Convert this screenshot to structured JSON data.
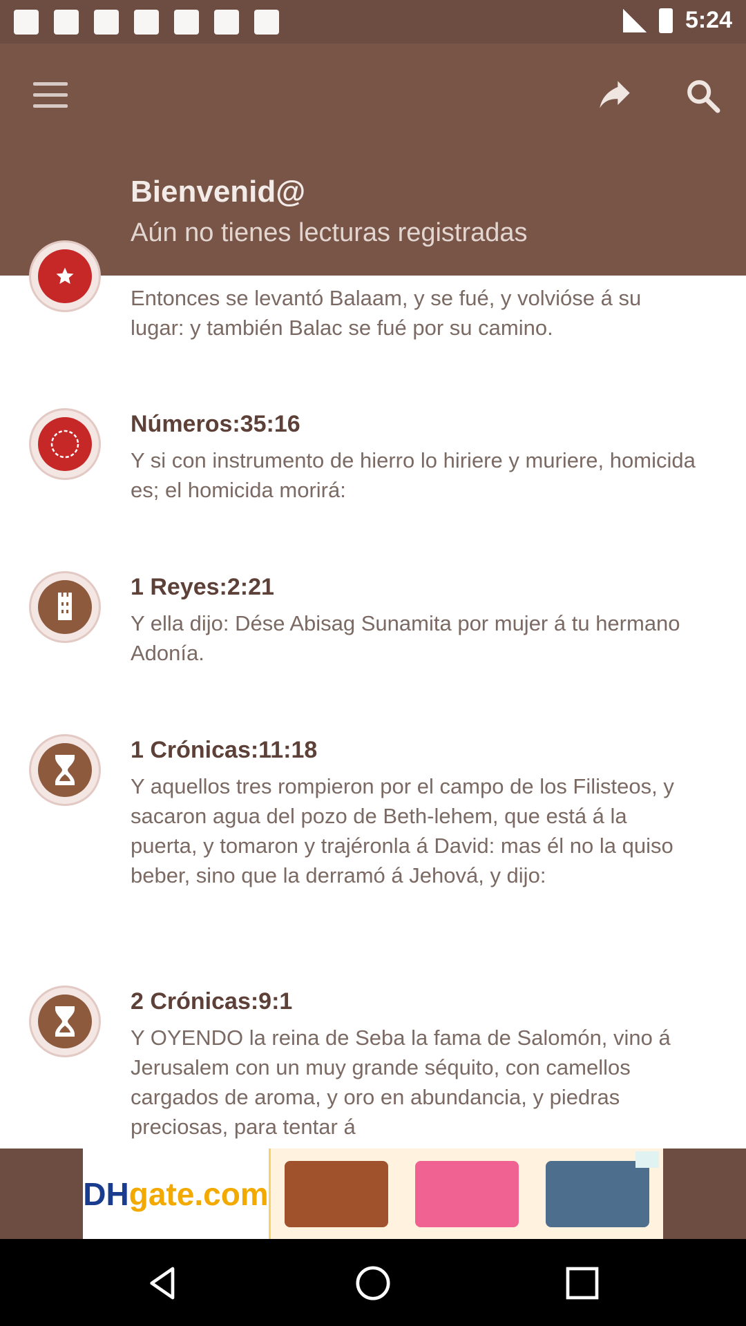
{
  "status_bar": {
    "time": "5:24"
  },
  "app_bar": {
    "welcome_title": "Bienvenid@",
    "welcome_subtitle": "Aún no tienes lecturas registradas",
    "icons": [
      "menu-icon",
      "share-icon",
      "search-icon"
    ]
  },
  "readings": [
    {
      "reference": "",
      "text": "Entonces se levantó Balaam, y se fué, y volvióse á su lugar: y también Balac se fué por su camino.",
      "badge_color": "#c62828"
    },
    {
      "reference": "Números:35:16",
      "text": "Y si con instrumento de hierro lo hiriere y muriere, homicida es; el homicida morirá:",
      "badge_color": "#c62828"
    },
    {
      "reference": "1 Reyes:2:21",
      "text": "Y ella dijo: Dése Abisag Sunamita por mujer á tu hermano Adonía.",
      "badge_color": "#8d5a3e"
    },
    {
      "reference": "1 Crónicas:11:18",
      "text": "Y aquellos tres rompieron por el campo de los Filisteos, y sacaron agua del pozo de Beth-lehem, que está á la puerta, y tomaron y trajéronla á David: mas él no la quiso beber, sino que la derramó á Jehová, y dijo:",
      "badge_color": "#8d5a3e"
    },
    {
      "reference": "2 Crónicas:9:1",
      "text": "Y OYENDO la reina de Seba la fama de Salomón, vino á Jerusalem con un muy grande séquito, con camellos cargados de aroma, y oro en abundancia, y piedras preciosas, para tentar á",
      "badge_color": "#8d5a3e"
    }
  ],
  "ad": {
    "logo_a": "DH",
    "logo_b": "gate.com"
  },
  "nav_bar": {
    "icons": [
      "back-icon",
      "home-icon",
      "recents-icon"
    ]
  }
}
